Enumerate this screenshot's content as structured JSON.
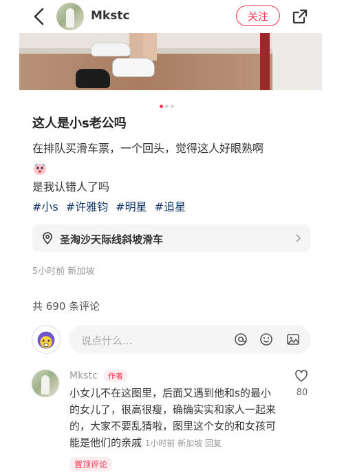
{
  "header": {
    "username": "Mkstc",
    "follow_label": "关注"
  },
  "carousel": {
    "total": 3,
    "active": 1
  },
  "post": {
    "title": "这人是小s老公吗",
    "line1": "在排队买滑车票，一个回头，觉得这人好眼熟啊",
    "line2": "是我认错人了吗",
    "tags": [
      "#小s",
      "#许雅钧",
      "#明星",
      "#追星"
    ],
    "location": "圣淘沙天际线斜坡滑车",
    "meta": "5小时前 新加坡"
  },
  "comments": {
    "count_text": "共 690 条评论",
    "input_placeholder": "说点什么...",
    "items": [
      {
        "name": "Mkstc",
        "badge": "作者",
        "text": "小女儿不在这图里，后面又遇到他和s的最小的女儿了，很高很瘦，确确实实和家人一起来的，大家不要乱猜啦，图里这个女的和女孩可能是他们的亲戚",
        "meta": "1小时前 新加坡 回复",
        "likes": "80",
        "pinned_label": "置顶评论"
      }
    ]
  },
  "colors": {
    "accent": "#ff2e4d",
    "tag": "#13386c"
  },
  "icons": [
    "back-arrow-icon",
    "share-icon",
    "location-pin-icon",
    "chevron-right-icon",
    "at-icon",
    "emoji-icon",
    "image-icon",
    "heart-icon"
  ]
}
